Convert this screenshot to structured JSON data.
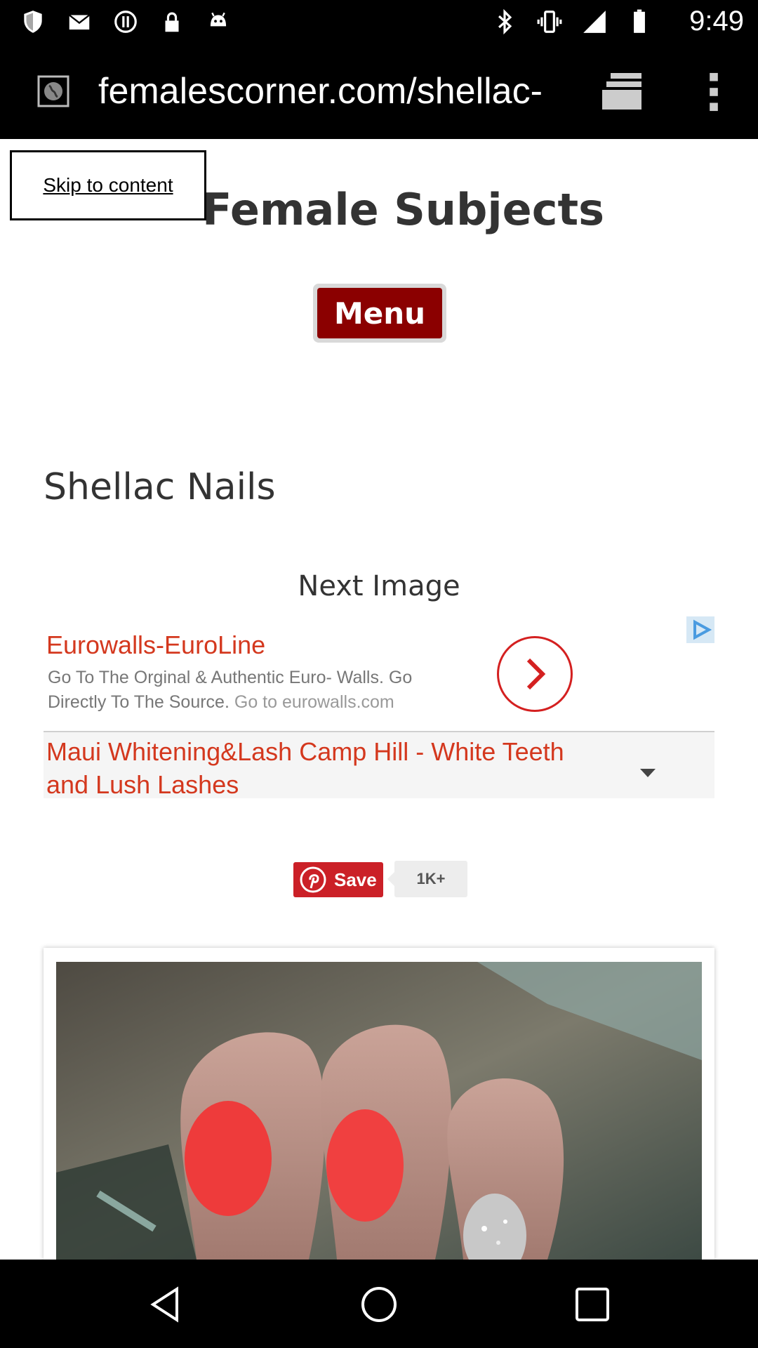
{
  "status_bar": {
    "time": "9:49",
    "left_icons": [
      "shield-icon",
      "mail-icon",
      "alert-icon",
      "lock-icon",
      "android-icon"
    ],
    "right_icons": [
      "bluetooth-icon",
      "vibrate-icon",
      "signal-icon",
      "battery-icon"
    ]
  },
  "browser": {
    "url": "femalescorner.com/shellac-",
    "icons": [
      "site-globe-icon",
      "tabs-icon",
      "more-vert-icon"
    ]
  },
  "page": {
    "skip_link": "Skip to content",
    "site_title": "Female Subjects",
    "menu_label": "Menu",
    "post_title": "Shellac Nails",
    "next_image": "Next Image"
  },
  "ad": {
    "title": "Eurowalls-EuroLine",
    "description": "Go To The Orginal & Authentic Euro- Walls. Go Directly To The Source.",
    "link_text": "Go to eurowalls.com",
    "second_title": "Maui Whitening&Lash Camp Hill - White Teeth and Lush Lashes",
    "colors": {
      "title": "#d4381e",
      "arrow": "#d42020",
      "badge": "#5aa6e6"
    }
  },
  "pinterest": {
    "save_label": "Save",
    "count": "1K+",
    "color": "#cb2027"
  },
  "nav_bar": {
    "buttons": [
      "back-icon",
      "home-icon",
      "recents-icon"
    ]
  }
}
